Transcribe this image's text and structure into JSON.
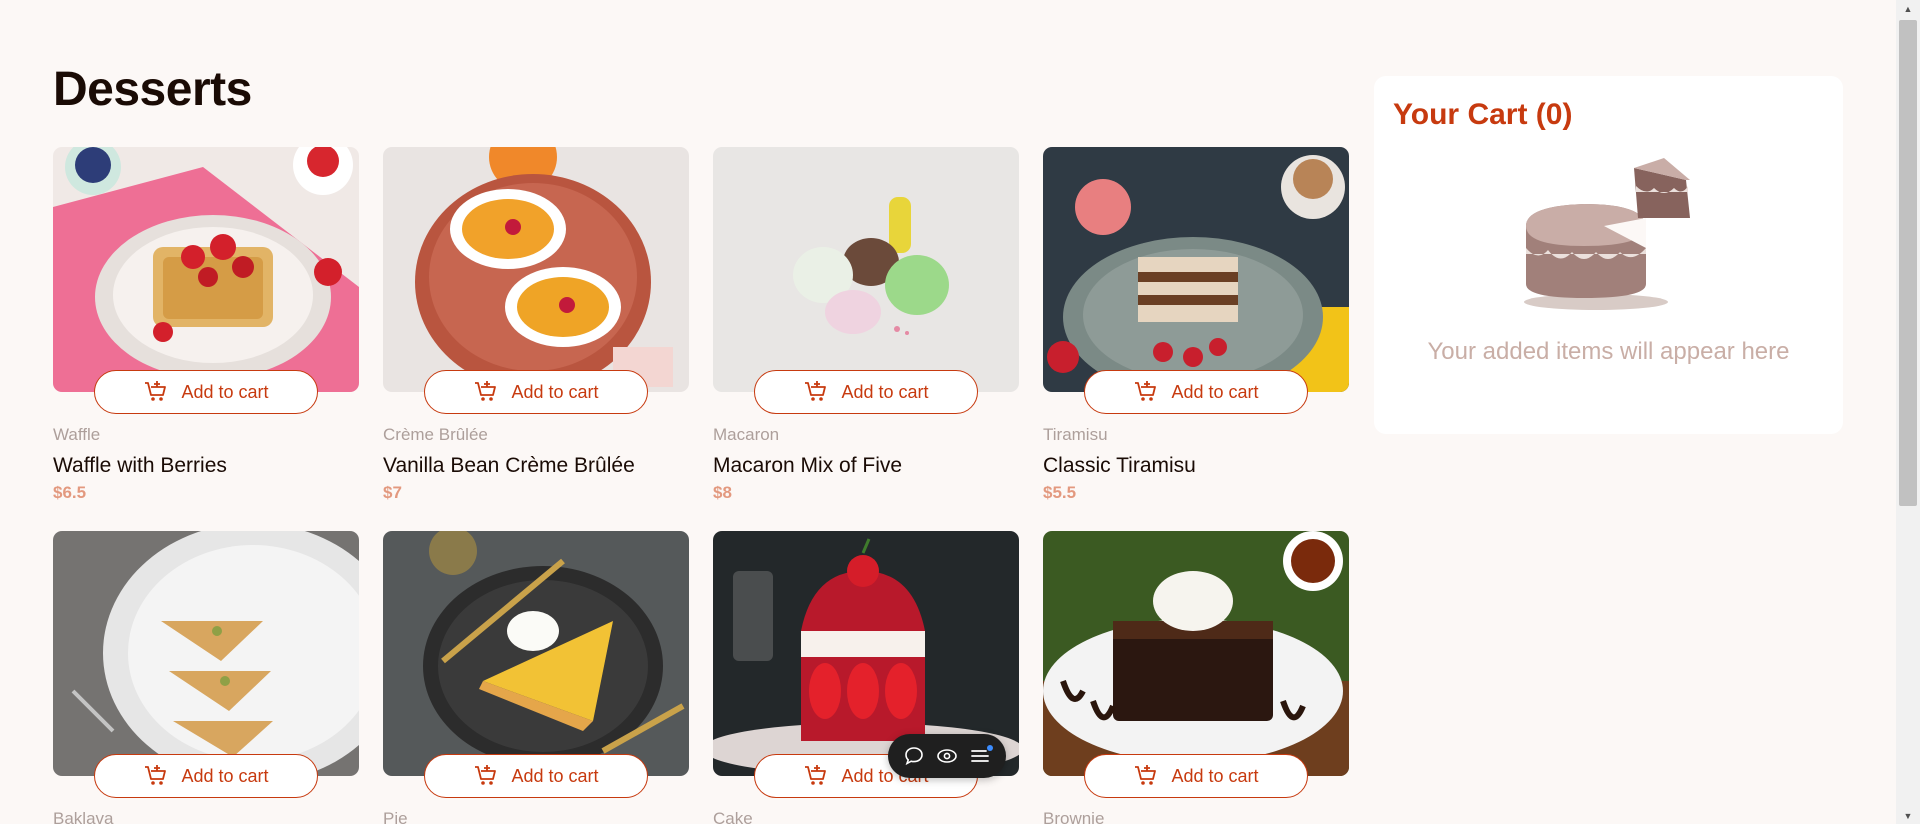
{
  "page": {
    "title": "Desserts"
  },
  "products": [
    {
      "category": "Waffle",
      "name": "Waffle with Berries",
      "price": "$6.5",
      "button_label": "Add to cart",
      "photo": "waffle"
    },
    {
      "category": "Crème Brûlée",
      "name": "Vanilla Bean Crème Brûlée",
      "price": "$7",
      "button_label": "Add to cart",
      "photo": "creme-brulee"
    },
    {
      "category": "Macaron",
      "name": "Macaron Mix of Five",
      "price": "$8",
      "button_label": "Add to cart",
      "photo": "macaron"
    },
    {
      "category": "Tiramisu",
      "name": "Classic Tiramisu",
      "price": "$5.5",
      "button_label": "Add to cart",
      "photo": "tiramisu"
    },
    {
      "category": "Baklava",
      "name": "",
      "price": "",
      "button_label": "Add to cart",
      "photo": "baklava"
    },
    {
      "category": "Pie",
      "name": "",
      "price": "",
      "button_label": "Add to cart",
      "photo": "pie"
    },
    {
      "category": "Cake",
      "name": "",
      "price": "",
      "button_label": "Add to cart",
      "photo": "cake"
    },
    {
      "category": "Brownie",
      "name": "",
      "price": "",
      "button_label": "Add to cart",
      "photo": "brownie"
    }
  ],
  "cart": {
    "title": "Your Cart (0)",
    "empty_message": "Your added items will appear here",
    "illustration": "empty-cake-illustration"
  },
  "floating_toolbar": {
    "items": [
      "chat-bubble-icon",
      "eye-icon",
      "menu-lines-icon"
    ]
  },
  "colors": {
    "background": "#fcf8f6",
    "accent": "#c73a0f",
    "price": "#e3997f",
    "muted_text": "#ad9f9b",
    "heading": "#1a0b05"
  }
}
